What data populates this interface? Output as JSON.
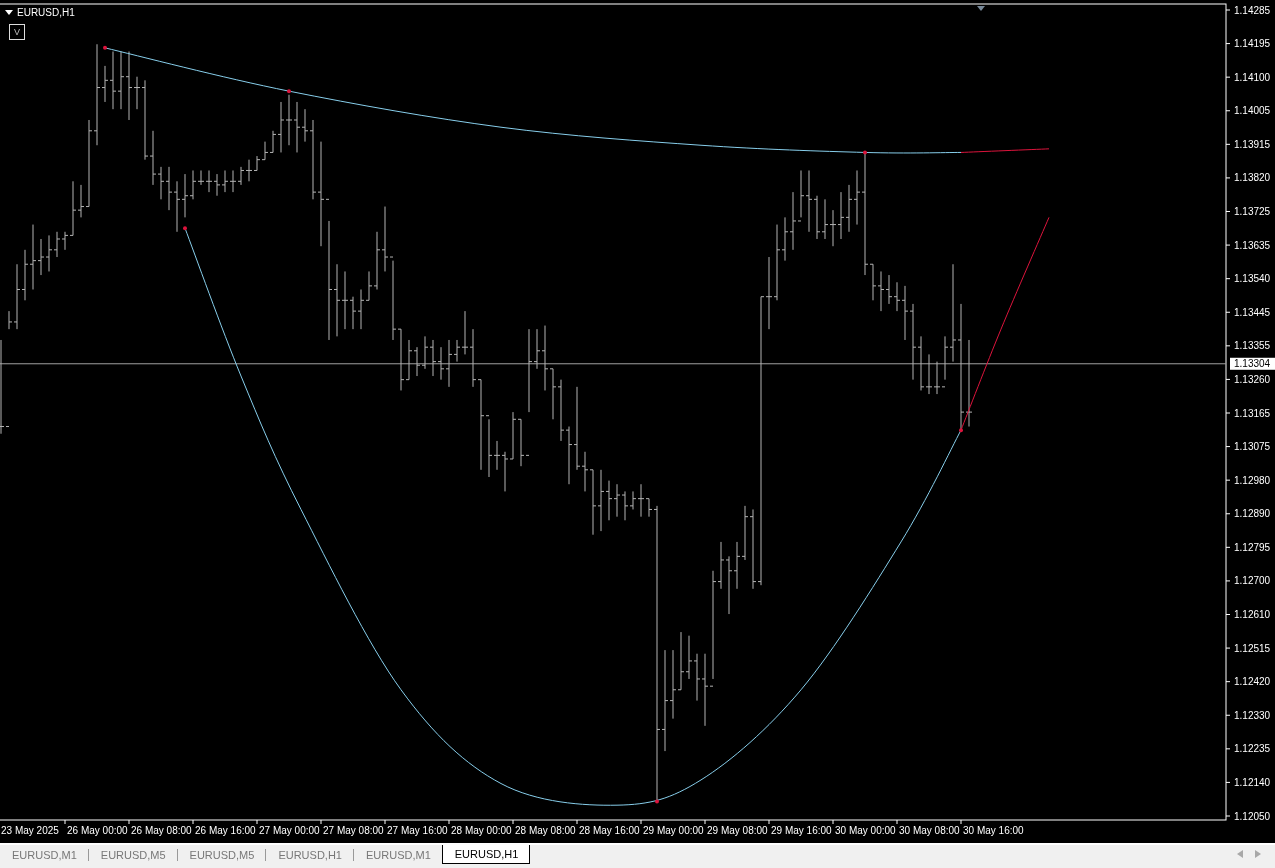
{
  "chart": {
    "symbol": "EURUSD,H1",
    "button": "V",
    "current_price": "1.13304",
    "price_labels": [
      "1.14285",
      "1.14195",
      "1.14100",
      "1.14005",
      "1.13915",
      "1.13820",
      "1.13725",
      "1.13635",
      "1.13540",
      "1.13445",
      "1.13355",
      "1.13260",
      "1.13165",
      "1.13075",
      "1.12980",
      "1.12890",
      "1.12795",
      "1.12700",
      "1.12610",
      "1.12515",
      "1.12420",
      "1.12330",
      "1.12235",
      "1.12140",
      "1.12050"
    ],
    "time_labels": [
      "23 May 2025",
      "26 May 00:00",
      "26 May 08:00",
      "26 May 16:00",
      "27 May 00:00",
      "27 May 08:00",
      "27 May 16:00",
      "28 May 00:00",
      "28 May 08:00",
      "28 May 16:00",
      "29 May 00:00",
      "29 May 08:00",
      "29 May 16:00",
      "30 May 00:00",
      "30 May 08:00",
      "30 May 16:00"
    ]
  },
  "tabs": [
    {
      "label": "EURUSD,M1",
      "selected": false
    },
    {
      "label": "EURUSD,M5",
      "selected": false
    },
    {
      "label": "EURUSD,M5",
      "selected": false
    },
    {
      "label": "EURUSD,H1",
      "selected": false
    },
    {
      "label": "EURUSD,M1",
      "selected": false
    },
    {
      "label": "EURUSD,H1",
      "selected": true
    }
  ]
}
